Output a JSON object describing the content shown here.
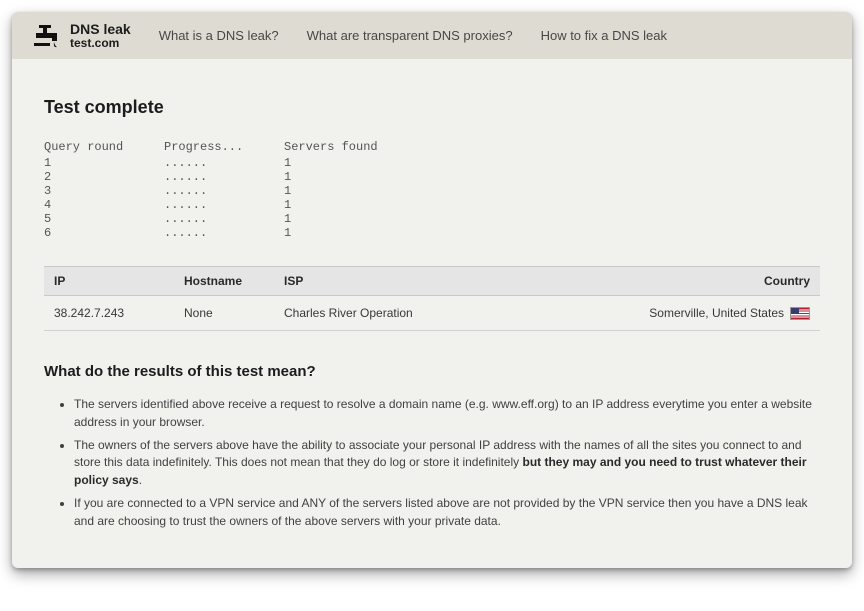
{
  "brand": {
    "line1": "DNS leak",
    "line2": "test.com"
  },
  "nav": {
    "link1": "What is a DNS leak?",
    "link2": "What are transparent DNS proxies?",
    "link3": "How to fix a DNS leak"
  },
  "headings": {
    "complete": "Test complete",
    "explain": "What do the results of this test mean?"
  },
  "progress": {
    "labels": {
      "round": "Query round",
      "prog": "Progress...",
      "found": "Servers found"
    },
    "dots": "......",
    "rows": [
      {
        "n": "1",
        "found": "1"
      },
      {
        "n": "2",
        "found": "1"
      },
      {
        "n": "3",
        "found": "1"
      },
      {
        "n": "4",
        "found": "1"
      },
      {
        "n": "5",
        "found": "1"
      },
      {
        "n": "6",
        "found": "1"
      }
    ]
  },
  "results": {
    "cols": {
      "ip": "IP",
      "hostname": "Hostname",
      "isp": "ISP",
      "country": "Country"
    },
    "rows": [
      {
        "ip": "38.242.7.243",
        "hostname": "None",
        "isp": "Charles River Operation",
        "country": "Somerville, United States"
      }
    ]
  },
  "explain": {
    "b1": "The servers identified above receive a request to resolve a domain name (e.g. www.eff.org) to an IP address everytime you enter a website address in your browser.",
    "b2a": "The owners of the servers above have the ability to associate your personal IP address with the names of all the sites you connect to and store this data indefinitely. This does not mean that they do log or store it indefinitely ",
    "b2b": "but they may and you need to trust whatever their policy says",
    "b2c": ".",
    "b3": "If you are connected to a VPN service and ANY of the servers listed above are not provided by the VPN service then you have a DNS leak and are choosing to trust the owners of the above servers with your private data."
  }
}
